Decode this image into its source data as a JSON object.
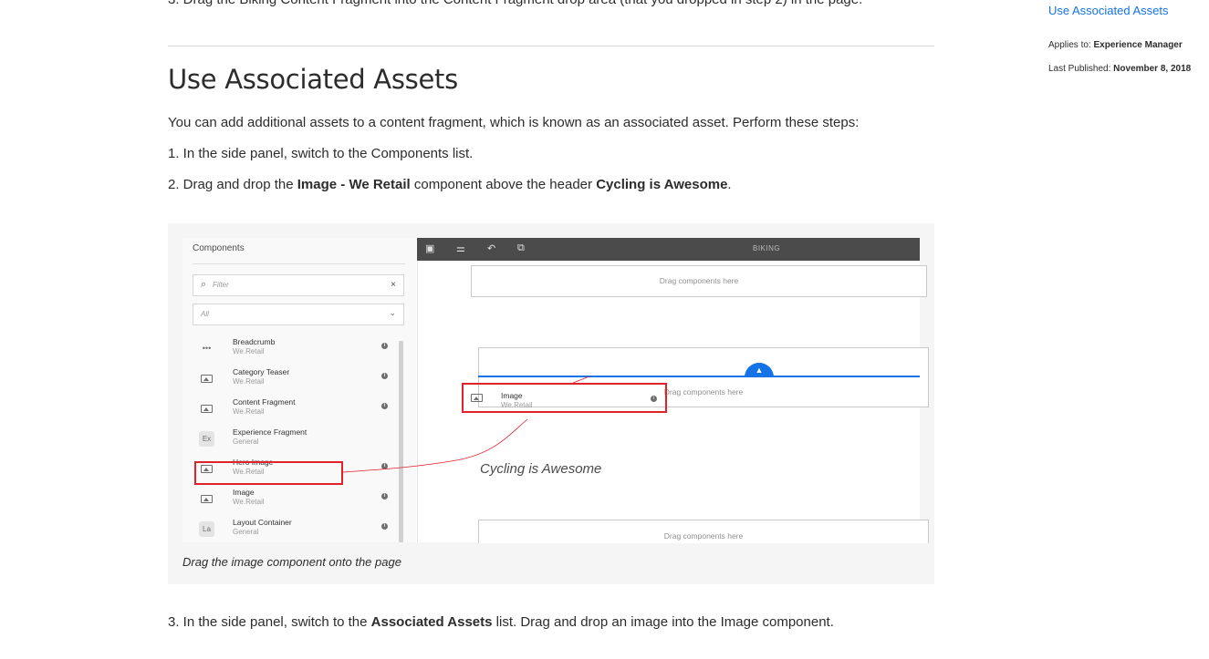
{
  "prev_step": "3. Drag the Biking Content Fragment into the Content Fragment drop area (that you dropped in step 2) in the page.",
  "section": {
    "title": "Use Associated Assets",
    "intro": "You can add additional assets to a content fragment, which is known as an associated asset. Perform these steps:",
    "step1": "1. In the side panel, switch to the Components list.",
    "step2": {
      "prefix": "2. Drag and drop the ",
      "component": "Image - We Retail",
      "middle": " component above the header ",
      "header": "Cycling is Awesome",
      "suffix": "."
    },
    "step3": {
      "prefix": "3. In the side panel, switch to the ",
      "list": "Associated Assets",
      "suffix": " list. Drag and drop an image into the Image component."
    }
  },
  "sidebar": {
    "toc_link": "Use Associated Assets",
    "applies_label": "Applies to:",
    "applies_value": "Experience Manager",
    "published_label": "Last Published:",
    "published_value": "November 8, 2018"
  },
  "figure": {
    "caption": "Drag the image component onto the page",
    "panel": {
      "title": "Components",
      "filter_placeholder": "Filter",
      "select_value": "All",
      "items": [
        {
          "name": "Breadcrumb",
          "group": "We.Retail",
          "icon": "more-icon"
        },
        {
          "name": "Category Teaser",
          "group": "We.Retail",
          "icon": "image-icon"
        },
        {
          "name": "Content Fragment",
          "group": "We.Retail",
          "icon": "fragment-icon"
        },
        {
          "name": "Experience Fragment",
          "group": "General",
          "icon": "Ex"
        },
        {
          "name": "Hero Image",
          "group": "We.Retail",
          "icon": "image-icon"
        },
        {
          "name": "Image",
          "group": "We.Retail",
          "icon": "image-icon"
        },
        {
          "name": "Layout Container",
          "group": "General",
          "icon": "La"
        }
      ]
    },
    "editor": {
      "toolbar_title": "BIKING",
      "drop_text": "Drag components here",
      "drop_text_2": "Drag components here",
      "drop_text_3": "Drag components here",
      "marker_label": "Image",
      "drag_item_name": "Image",
      "drag_item_group": "We.Retail",
      "page_heading": "Cycling is Awesome"
    }
  },
  "colors": {
    "link": "#1473e6",
    "highlight": "#e0232b",
    "toolbar": "#4b4b4b"
  }
}
